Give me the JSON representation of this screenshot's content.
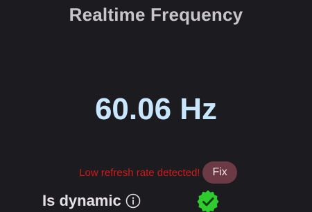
{
  "header": {
    "title": "Realtime Frequency"
  },
  "frequency": {
    "value_text": "60.06 Hz"
  },
  "warning": {
    "text": "Low refresh rate detected!",
    "fix_label": "Fix"
  },
  "dynamic": {
    "label": "Is dynamic",
    "info_icon": "info-icon",
    "status_icon": "check-badge-icon"
  },
  "colors": {
    "background": "#1c1b1f",
    "title": "#c8c5ca",
    "frequency": "#c9e6ff",
    "warning": "#d21a1a",
    "fix_button_bg": "#6b3a44",
    "check_badge": "#2ecc2e"
  }
}
